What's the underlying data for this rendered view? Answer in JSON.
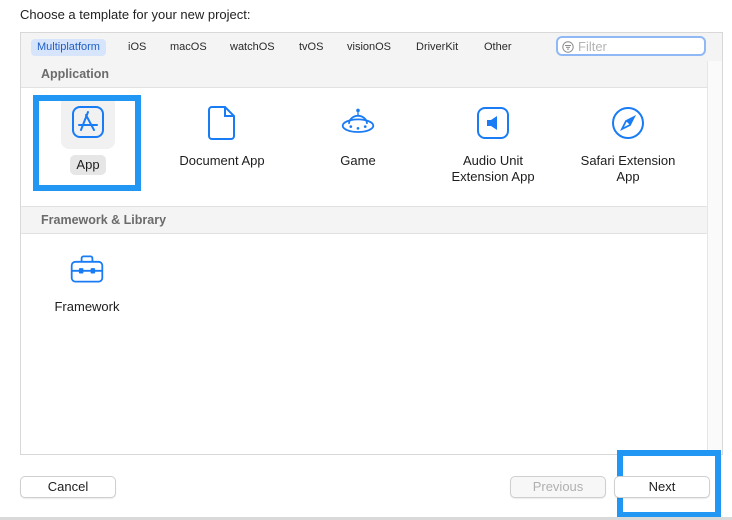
{
  "header": {
    "title": "Choose a template for your new project:"
  },
  "tabs": [
    {
      "label": "Multiplatform",
      "selected": true
    },
    {
      "label": "iOS"
    },
    {
      "label": "macOS"
    },
    {
      "label": "watchOS"
    },
    {
      "label": "tvOS"
    },
    {
      "label": "visionOS"
    },
    {
      "label": "DriverKit"
    },
    {
      "label": "Other"
    }
  ],
  "filter": {
    "placeholder": "Filter",
    "icon": "filter-icon"
  },
  "sections": [
    {
      "title": "Application",
      "templates": [
        {
          "label": "App",
          "icon": "app-store-icon",
          "selected": true
        },
        {
          "label": "Document App",
          "icon": "document-icon"
        },
        {
          "label": "Game",
          "icon": "game-ufo-icon"
        },
        {
          "label_line1": "Audio Unit",
          "label_line2": "Extension App",
          "icon": "audio-unit-icon"
        },
        {
          "label_line1": "Safari Extension",
          "label_line2": "App",
          "icon": "compass-icon"
        }
      ]
    },
    {
      "title": "Framework & Library",
      "templates": [
        {
          "label": "Framework",
          "icon": "toolbox-icon"
        }
      ]
    }
  ],
  "buttons": {
    "cancel": "Cancel",
    "previous": "Previous",
    "next": "Next"
  },
  "colors": {
    "accent": "#1a7cf5",
    "highlight_box": "#2196f3",
    "selected_tab_bg": "#d6e5fb"
  }
}
